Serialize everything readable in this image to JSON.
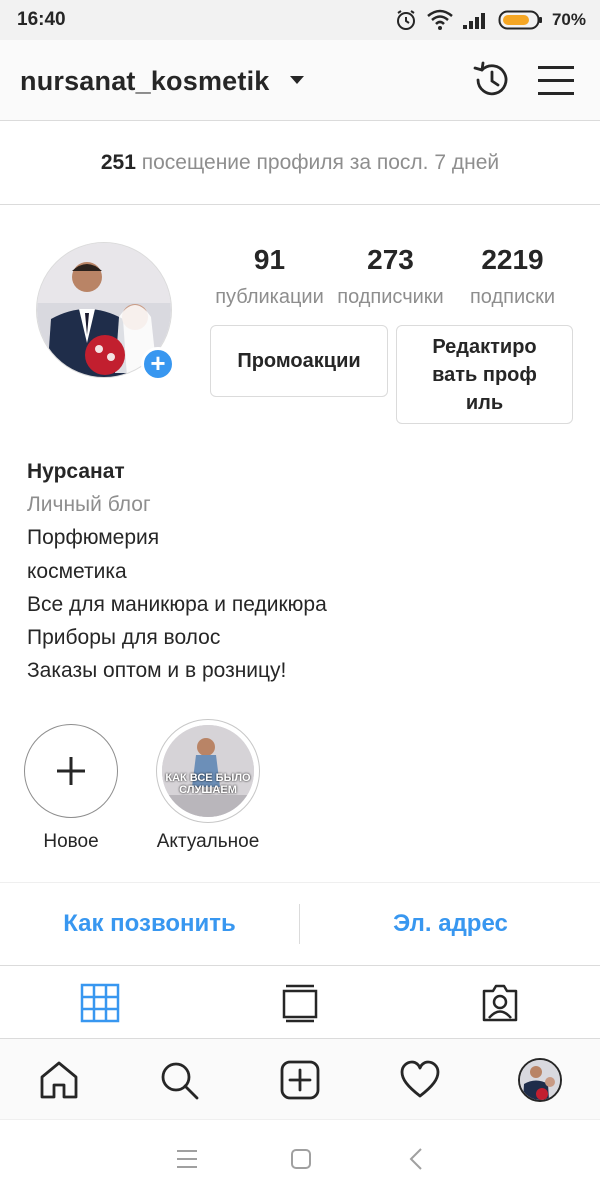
{
  "status_bar": {
    "time": "16:40",
    "battery_percent": "70%",
    "icons": [
      "alarm-icon",
      "wifi-icon",
      "signal-icon",
      "battery-icon"
    ]
  },
  "header": {
    "username": "nursanat_kosmetik",
    "icons": [
      "chevron-down-icon",
      "history-icon",
      "menu-icon"
    ]
  },
  "insights": {
    "count": "251",
    "text": "посещение профиля за посл. 7 дней"
  },
  "profile": {
    "stats": [
      {
        "value": "91",
        "label": "публикации"
      },
      {
        "value": "273",
        "label": "подписчики"
      },
      {
        "value": "2219",
        "label": "подписки"
      }
    ],
    "promote_button": "Промоакции",
    "edit_button": "Редактировать профиль",
    "name": "Нурсанат",
    "category": "Личный блог",
    "bio_lines": [
      "Порфюмерия",
      "косметика",
      "Все для маникюра и педикюра",
      "Приборы для волос",
      "Заказы оптом и в розницу!"
    ]
  },
  "highlights": [
    {
      "label": "Новое",
      "type": "new"
    },
    {
      "label": "Актуальное",
      "type": "story",
      "cover_text": "КАК ВСЕ БЫЛО СЛУШАЕМ"
    }
  ],
  "contact_buttons": {
    "call": "Как позвонить",
    "email": "Эл. адрес"
  },
  "tabs": [
    "grid-icon",
    "feed-icon",
    "tagged-icon"
  ],
  "bottom_nav": [
    "home-icon",
    "search-icon",
    "add-post-icon",
    "heart-icon",
    "profile-avatar"
  ],
  "system_nav": [
    "recents-icon",
    "home-square-icon",
    "back-icon"
  ],
  "colors": {
    "accent": "#3897f0",
    "text": "#262626",
    "secondary_text": "#8e8e8e",
    "border": "#dbdbdb",
    "battery": "#f5a623"
  }
}
